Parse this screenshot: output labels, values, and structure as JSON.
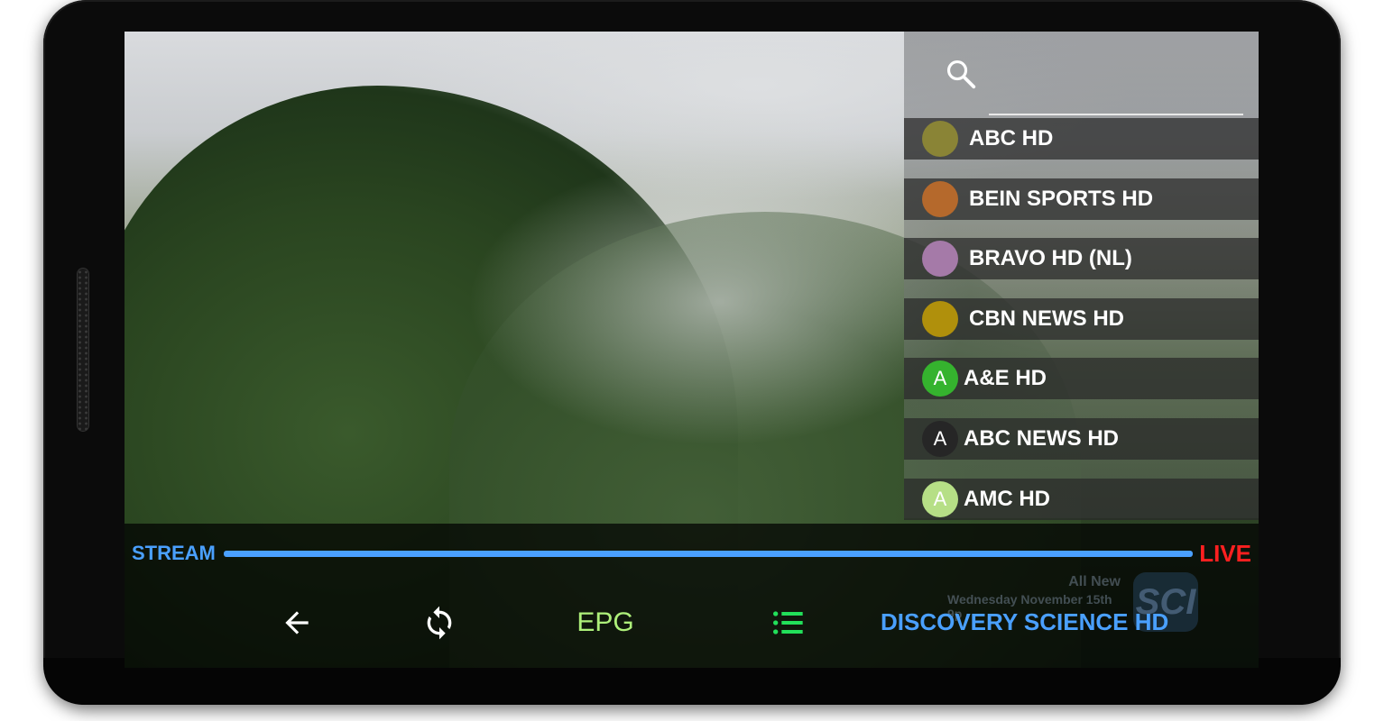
{
  "channels": [
    {
      "name": "ABC HD",
      "logo_color": "#8a8436",
      "logo_letter": ""
    },
    {
      "name": "BEIN SPORTS HD",
      "logo_color": "#b5692c",
      "logo_letter": ""
    },
    {
      "name": "BRAVO HD (NL)",
      "logo_color": "#a57aa8",
      "logo_letter": ""
    },
    {
      "name": "CBN NEWS HD",
      "logo_color": "#b0900c",
      "logo_letter": ""
    },
    {
      "name": "A&E HD",
      "logo_color": "#35b32e",
      "logo_letter": "A"
    },
    {
      "name": "ABC NEWS HD",
      "logo_color": "#262626",
      "logo_letter": "A"
    },
    {
      "name": "AMC HD",
      "logo_color": "#b6df86",
      "logo_letter": "A"
    }
  ],
  "player": {
    "stream_label": "STREAM",
    "live_label": "LIVE",
    "progress": 1.0,
    "epg_label": "EPG",
    "current_channel": "DISCOVERY SCIENCE HD",
    "progress_color": "#4aa0ff",
    "live_color": "#ff2020"
  },
  "watermark": {
    "line1": "All New",
    "line2": "Wednesday November 15th 9p",
    "logo_text": "SCI"
  },
  "icons": {
    "search": "search-icon",
    "back": "arrow-left-icon",
    "refresh": "refresh-icon",
    "list": "list-icon"
  }
}
